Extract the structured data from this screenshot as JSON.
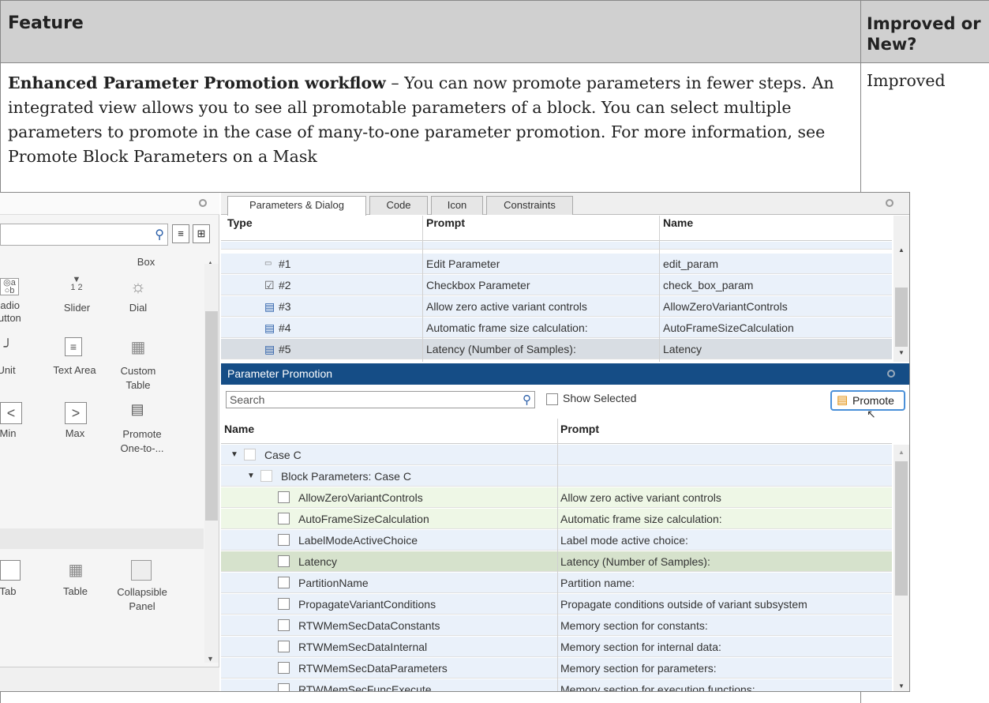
{
  "table": {
    "header_feature": "Feature",
    "header_improved": "Improved or New?",
    "row_title": "Enhanced Parameter Promotion workflow",
    "row_dash": " – ",
    "row_description": "You can now promote parameters in fewer steps. An integrated view allows you to see all promotable parameters of a block. You can select multiple parameters to promote in the case of many-to-one parameter promotion. For more information, see Promote Block Parameters on a Mask",
    "row_status": "Improved"
  },
  "palette": {
    "items": [
      {
        "label": "Box",
        "icon": "box-icon"
      },
      {
        "label": "Radio Button",
        "icon": "radio-button-icon"
      },
      {
        "label": "Slider",
        "icon": "slider-icon"
      },
      {
        "label": "Dial",
        "icon": "dial-icon"
      },
      {
        "label": "Unit",
        "icon": "unit-icon"
      },
      {
        "label": "Text Area",
        "icon": "text-area-icon"
      },
      {
        "label": "Custom Table",
        "icon": "custom-table-icon"
      },
      {
        "label": "Min",
        "icon": "min-icon"
      },
      {
        "label": "Max",
        "icon": "max-icon"
      },
      {
        "label": "Promote One-to-...",
        "icon": "promote-icon"
      },
      {
        "label": "Tab",
        "icon": "tab-icon"
      },
      {
        "label": "Table",
        "icon": "table-icon"
      },
      {
        "label": "Collapsible Panel",
        "icon": "collapsible-panel-icon"
      }
    ]
  },
  "tabs": [
    "Parameters & Dialog",
    "Code",
    "Icon",
    "Constraints"
  ],
  "param_grid": {
    "headers": [
      "Type",
      "Prompt",
      "Name"
    ],
    "rows": [
      {
        "type": "#1",
        "prompt": "Edit Parameter",
        "name": "edit_param"
      },
      {
        "type": "#2",
        "prompt": "Checkbox Parameter",
        "name": "check_box_param"
      },
      {
        "type": "#3",
        "prompt": "Allow zero active variant controls",
        "name": "AllowZeroVariantControls"
      },
      {
        "type": "#4",
        "prompt": "Automatic frame size calculation:",
        "name": "AutoFrameSizeCalculation"
      },
      {
        "type": "#5",
        "prompt": "Latency (Number of Samples):",
        "name": "Latency"
      }
    ]
  },
  "promotion": {
    "title": "Parameter Promotion",
    "search_placeholder": "Search",
    "show_selected": "Show Selected",
    "promote_label": "Promote",
    "headers": [
      "Name",
      "Prompt"
    ],
    "tree": [
      {
        "name": "Case C",
        "prompt": ""
      },
      {
        "name": "Block Parameters: Case C",
        "prompt": ""
      }
    ],
    "rows": [
      {
        "name": "AllowZeroVariantControls",
        "prompt": "Allow zero active variant controls"
      },
      {
        "name": "AutoFrameSizeCalculation",
        "prompt": "Automatic frame size calculation:"
      },
      {
        "name": "LabelModeActiveChoice",
        "prompt": "Label mode active choice:"
      },
      {
        "name": "Latency",
        "prompt": "Latency (Number of Samples):"
      },
      {
        "name": "PartitionName",
        "prompt": "Partition name:"
      },
      {
        "name": "PropagateVariantConditions",
        "prompt": "Propagate conditions outside of variant subsystem"
      },
      {
        "name": "RTWMemSecDataConstants",
        "prompt": "Memory section for constants:"
      },
      {
        "name": "RTWMemSecDataInternal",
        "prompt": "Memory section for internal data:"
      },
      {
        "name": "RTWMemSecDataParameters",
        "prompt": "Memory section for parameters:"
      },
      {
        "name": "RTWMemSecFuncExecute",
        "prompt": "Memory section for execution functions:"
      }
    ]
  }
}
